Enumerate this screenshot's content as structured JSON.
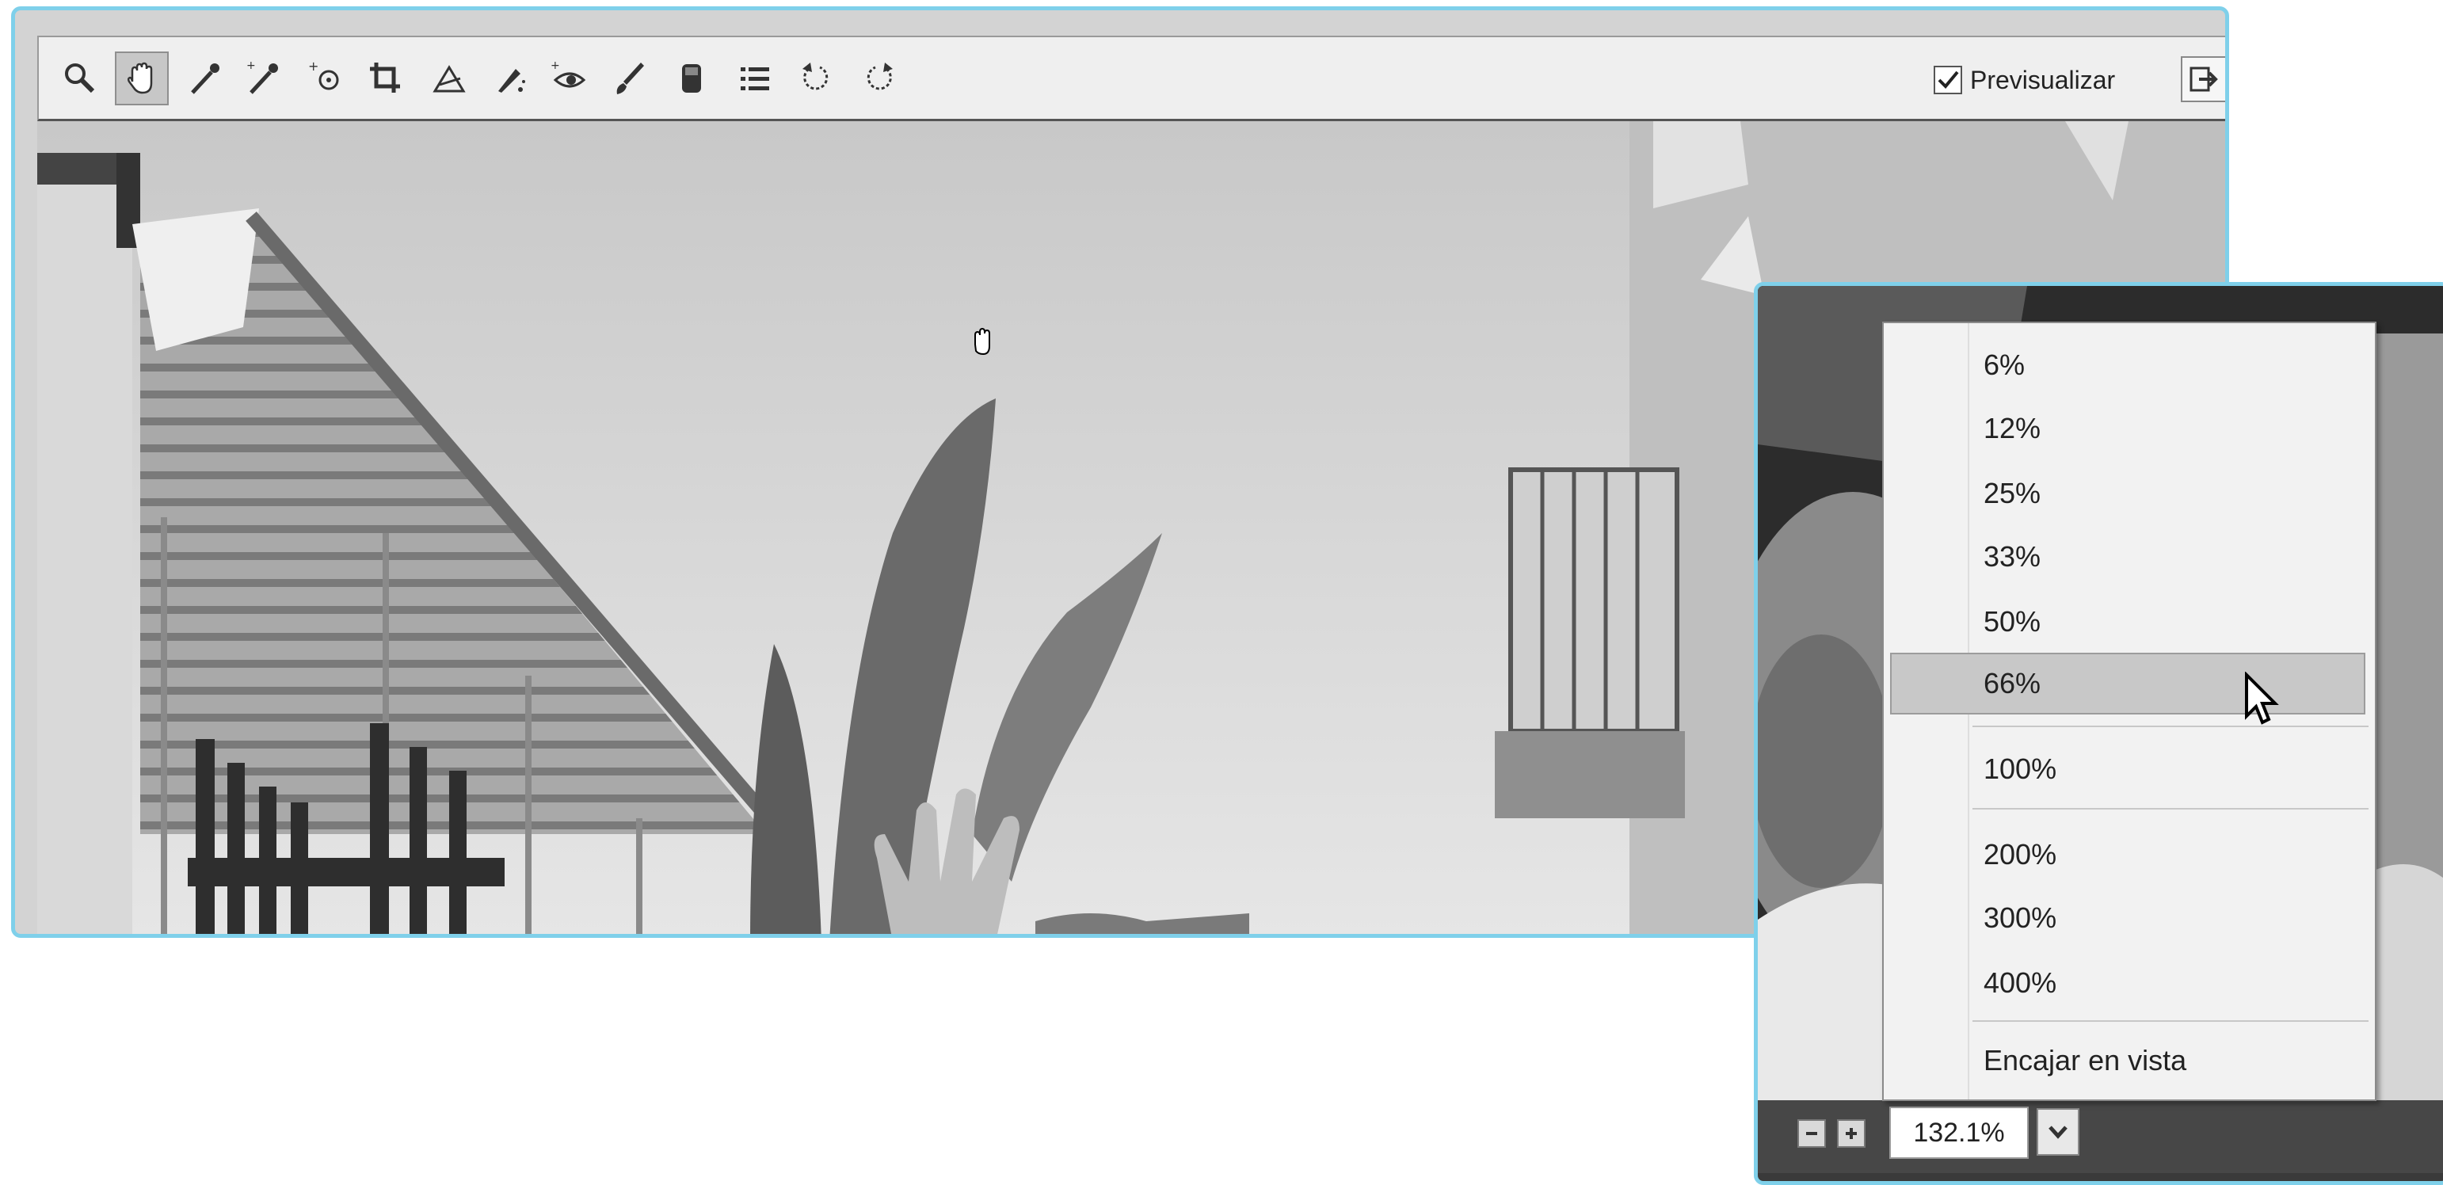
{
  "toolbar": {
    "tools": [
      {
        "name": "zoom-tool-icon"
      },
      {
        "name": "hand-tool-icon",
        "active": true
      },
      {
        "name": "white-balance-tool-icon"
      },
      {
        "name": "color-sampler-tool-icon"
      },
      {
        "name": "targeted-adjustment-tool-icon"
      },
      {
        "name": "crop-tool-icon"
      },
      {
        "name": "straighten-tool-icon"
      },
      {
        "name": "spot-removal-tool-icon"
      },
      {
        "name": "red-eye-removal-tool-icon"
      },
      {
        "name": "adjustment-brush-icon"
      },
      {
        "name": "graduated-filter-icon"
      },
      {
        "name": "preferences-list-icon"
      },
      {
        "name": "rotate-left-icon"
      },
      {
        "name": "rotate-right-icon"
      }
    ],
    "preview_label": "Previsualizar",
    "preview_checked": true
  },
  "zoom_menu": {
    "items": [
      "6%",
      "12%",
      "25%",
      "33%",
      "50%",
      "66%",
      "100%",
      "200%",
      "300%",
      "400%",
      "Encajar en vista"
    ],
    "selected": "66%"
  },
  "zoom_bar": {
    "minus_icon": "minus-icon",
    "plus_icon": "plus-icon",
    "zoom_value": "132.1%",
    "dropdown_icon": "chevron-down-icon"
  },
  "colors": {
    "window_border": "#7fd0ea",
    "toolbar_bg": "#efefef",
    "menu_bg": "#f2f2f2",
    "menu_selected": "#c8c8c8"
  }
}
